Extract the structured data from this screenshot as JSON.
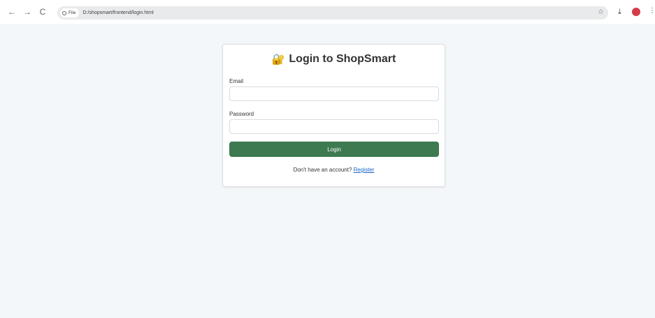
{
  "browser": {
    "chip_label": "File",
    "url": "D:/shopsmart/frontend/login.html",
    "back_glyph": "←",
    "forward_glyph": "→",
    "reload_glyph": "C",
    "star_glyph": "☆",
    "download_glyph": "⤓",
    "menu_glyph": "⋮",
    "icons": [
      "back-icon",
      "forward-icon",
      "reload-icon",
      "info-icon",
      "star-icon",
      "download-icon",
      "profile-avatar",
      "menu-icon"
    ]
  },
  "login": {
    "lock_glyph": "🔐",
    "title": "Login to ShopSmart",
    "email_label": "Email",
    "email_value": "",
    "password_label": "Password",
    "password_value": "",
    "button_label": "Login",
    "register_prompt": "Don't have an account?",
    "register_link": "Register"
  },
  "colors": {
    "page_bg": "#f4f7f9",
    "button_bg": "#3d7a50",
    "link": "#1a66c9",
    "avatar": "#d63b48"
  }
}
